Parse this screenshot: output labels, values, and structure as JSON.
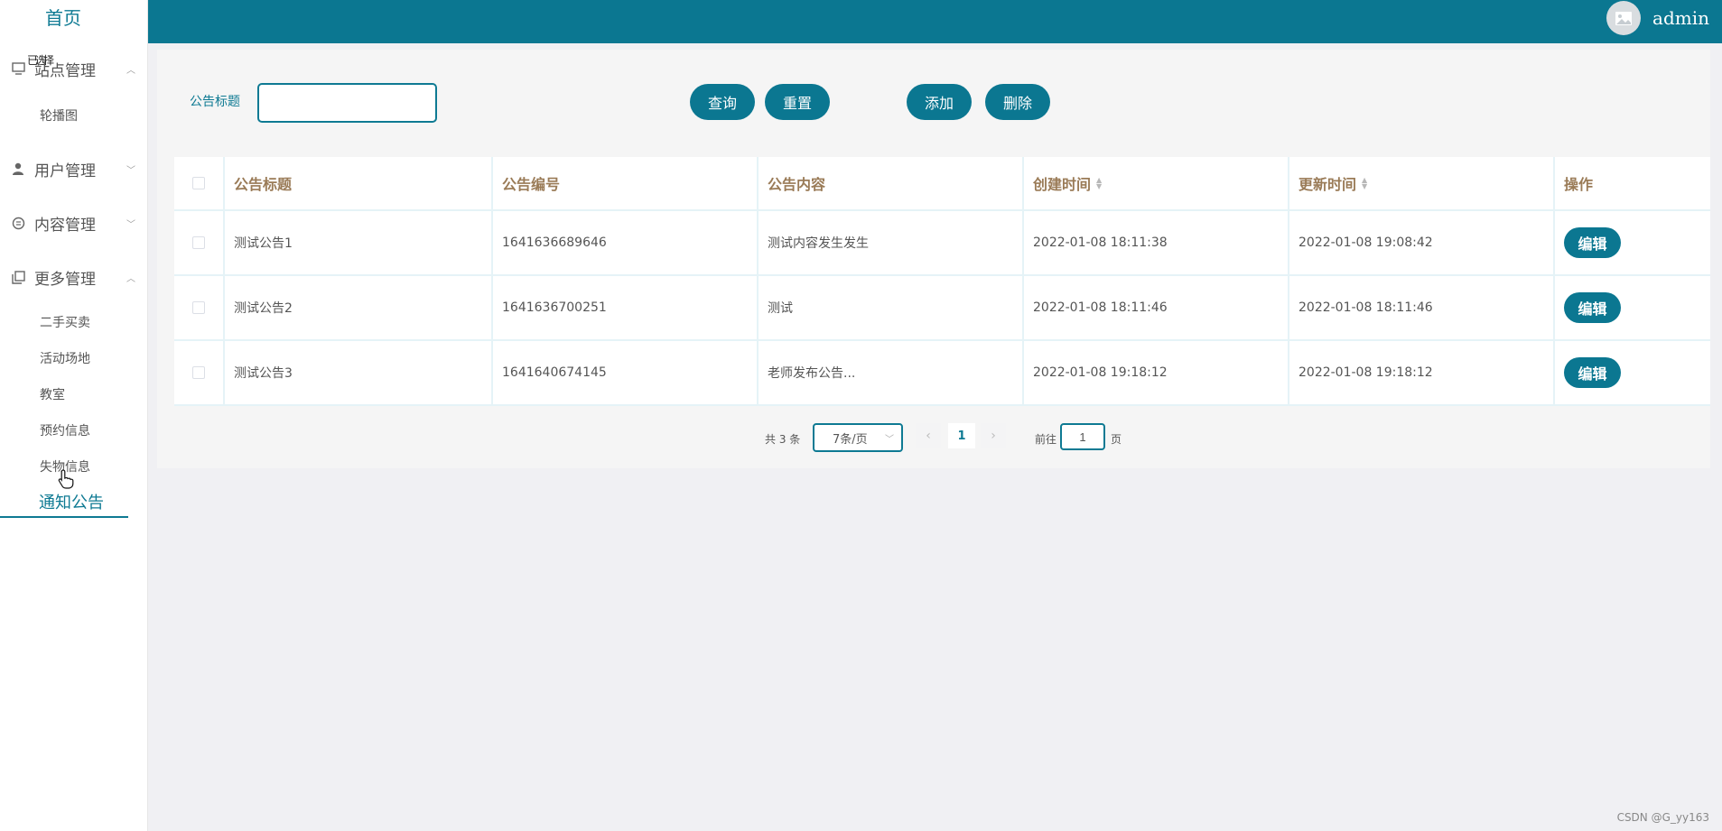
{
  "sidebar": {
    "home": "首页",
    "overlay_text": "已选择",
    "groups": [
      {
        "label": "站点管理",
        "icon": "monitor-icon",
        "expanded": true
      },
      {
        "label": "用户管理",
        "icon": "user-icon",
        "expanded": false
      },
      {
        "label": "内容管理",
        "icon": "chat-icon",
        "expanded": false
      },
      {
        "label": "更多管理",
        "icon": "copy-icon",
        "expanded": true
      }
    ],
    "site_items": [
      "轮播图"
    ],
    "more_items": [
      "二手买卖",
      "活动场地",
      "教室",
      "预约信息",
      "失物信息"
    ],
    "active_item": "通知公告"
  },
  "header": {
    "username": "admin"
  },
  "search": {
    "label": "公告标题",
    "value": "",
    "placeholder": ""
  },
  "toolbar": {
    "query": "查询",
    "reset": "重置",
    "add": "添加",
    "delete": "删除"
  },
  "table": {
    "columns": [
      "公告标题",
      "公告编号",
      "公告内容",
      "创建时间",
      "更新时间",
      "操作"
    ],
    "rows": [
      {
        "title": "测试公告1",
        "code": "1641636689646",
        "content": "测试内容发生发生",
        "created": "2022-01-08 18:11:38",
        "updated": "2022-01-08 19:08:42",
        "action": "编辑"
      },
      {
        "title": "测试公告2",
        "code": "1641636700251",
        "content": "测试",
        "created": "2022-01-08 18:11:46",
        "updated": "2022-01-08 18:11:46",
        "action": "编辑"
      },
      {
        "title": "测试公告3",
        "code": "1641640674145",
        "content": "老师发布公告...",
        "created": "2022-01-08 19:18:12",
        "updated": "2022-01-08 19:18:12",
        "action": "编辑"
      }
    ]
  },
  "pagination": {
    "total": "共 3 条",
    "page_size": "7条/页",
    "current_page": "1",
    "goto_prefix": "前往",
    "goto_value": "1",
    "goto_suffix": "页"
  },
  "watermark": "CSDN @G_yy163",
  "colors": {
    "primary": "#0b7791",
    "header_text": "#9a7b57",
    "background": "#f0f0f3"
  }
}
